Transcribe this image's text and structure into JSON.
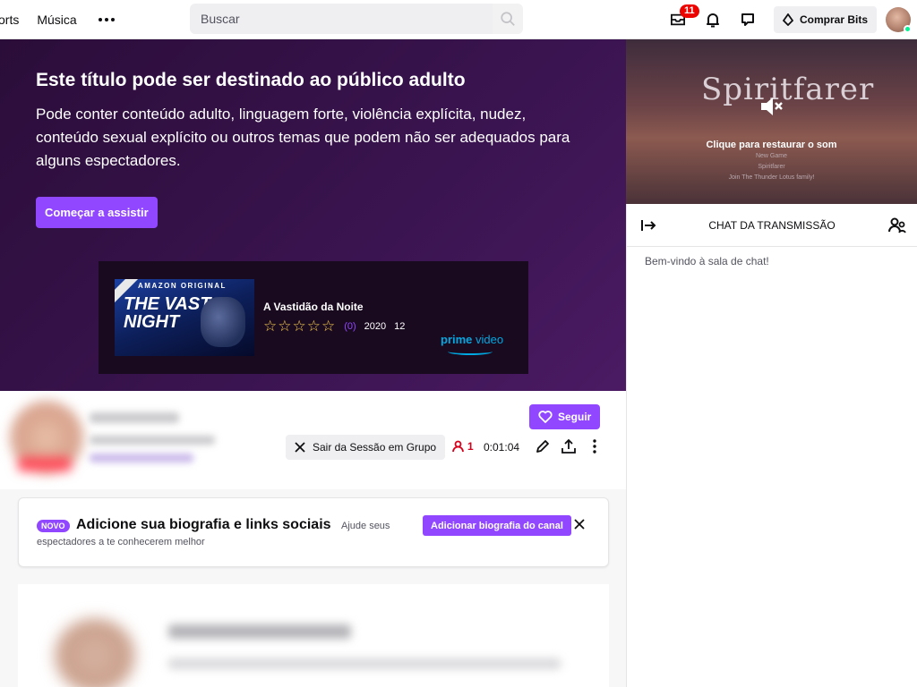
{
  "nav": {
    "links": [
      "orts",
      "Música"
    ],
    "search_placeholder": "Buscar",
    "inbox_badge": "11",
    "buy_bits_label": "Comprar Bits"
  },
  "mature_gate": {
    "title": "Este título pode ser destinado ao público adulto",
    "description": "Pode conter conteúdo adulto, linguagem forte, violência explícita, nudez, conteúdo sexual explícito ou outros temas que podem não ser adequados para alguns espectadores.",
    "start_button": "Começar a assistir"
  },
  "ad": {
    "poster_brand": "AMAZON ORIGINAL",
    "poster_title_line1": "THE VAST",
    "poster_title_line2": "NIGHT",
    "title": "A Vastidão da Noite",
    "stars": "☆☆☆☆☆",
    "rating_count": "(0)",
    "year": "2020",
    "age_rating": "12",
    "prime_brand": "prime",
    "prime_video": "video"
  },
  "player": {
    "logo_text": "Spiritfarer",
    "restore_sound": "Clique para restaurar o som",
    "credits": [
      "New Game",
      "Spiritfarer",
      "Join The Thunder Lotus family!"
    ]
  },
  "chat": {
    "title": "CHAT DA TRANSMISSÃO",
    "welcome": "Bem-vindo à sala de chat!"
  },
  "channel": {
    "follow_label": "Seguir",
    "exit_group_label": "Sair da Sessão em Grupo",
    "viewer_count": "1",
    "uptime": "0:01:04"
  },
  "bio_card": {
    "badge": "NOVO",
    "title": "Adicione sua biografia e links sociais",
    "subtitle_a": "Ajude seus",
    "subtitle_b": "espectadores a te conhecerem melhor",
    "add_button": "Adicionar biografia do canal"
  },
  "colors": {
    "accent": "#9147ff",
    "mature_bg": "#3a1450",
    "live_red": "#eb0400"
  }
}
